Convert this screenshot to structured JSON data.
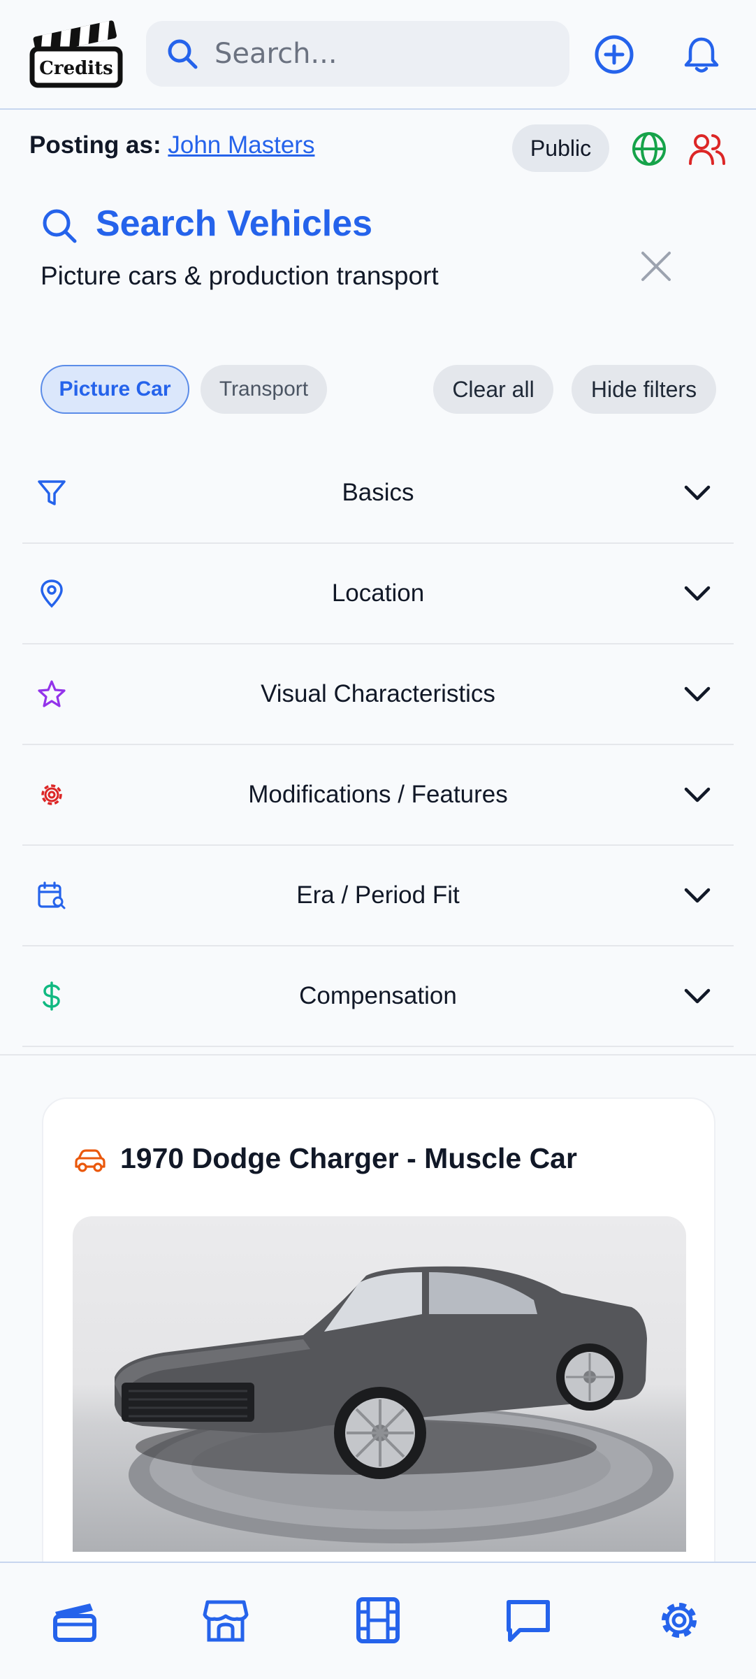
{
  "header": {
    "logo_text": "Credits",
    "search_placeholder": "Search...",
    "icons": [
      "search-icon",
      "add-circle-icon",
      "bell-icon"
    ]
  },
  "posting": {
    "label": "Posting as:",
    "user": "John Masters",
    "visibility": "Public",
    "icons": [
      "globe-icon",
      "users-icon"
    ]
  },
  "search_panel": {
    "title": "Search Vehicles",
    "subtitle": "Picture cars & production transport"
  },
  "filters": {
    "chips": [
      "Picture Car",
      "Transport"
    ],
    "active_chip": "Picture Car",
    "clear_label": "Clear all",
    "hide_label": "Hide filters"
  },
  "sections": [
    {
      "label": "Basics",
      "icon": "filter-icon",
      "color": "#2563eb"
    },
    {
      "label": "Location",
      "icon": "map-pin-icon",
      "color": "#2563eb"
    },
    {
      "label": "Visual Characteristics",
      "icon": "star-icon",
      "color": "#9333ea"
    },
    {
      "label": "Modifications / Features",
      "icon": "gear-icon",
      "color": "#dc2626"
    },
    {
      "label": "Era / Period Fit",
      "icon": "calendar-search-icon",
      "color": "#2563eb"
    },
    {
      "label": "Compensation",
      "icon": "dollar-icon",
      "color": "#10b981"
    }
  ],
  "listing": {
    "title": "1970 Dodge Charger - Muscle Car",
    "icon": "car-icon",
    "icon_color": "#ea580c"
  },
  "bottom_nav": [
    "clapperboard-icon",
    "store-icon",
    "film-icon",
    "chat-icon",
    "settings-icon"
  ],
  "colors": {
    "accent": "#2563eb",
    "background": "#f8fafc"
  }
}
